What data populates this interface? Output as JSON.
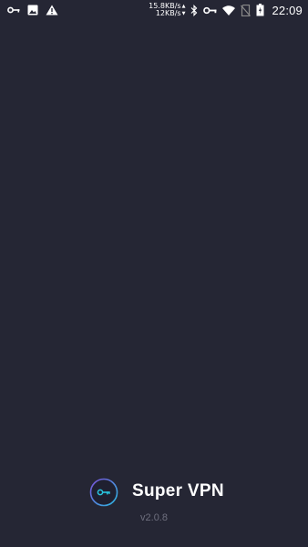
{
  "status_bar": {
    "icons_left": [
      "vpn-key-icon",
      "image-icon",
      "warning-icon"
    ],
    "download_speed": "15.8KB/s",
    "upload_speed": "12KB/s",
    "icons_right": [
      "bluetooth-icon",
      "vpn-key-icon",
      "wifi-icon",
      "no-sim-icon",
      "battery-icon"
    ],
    "time": "22:09"
  },
  "splash": {
    "app_name": "Super VPN",
    "version": "v2.0.8",
    "logo_icon": "key-in-circle-icon"
  },
  "colors": {
    "background": "#252634",
    "logo_accent": "#29c6e0",
    "logo_ring": "#6a5bd6",
    "version_text": "#6e6f7e"
  }
}
